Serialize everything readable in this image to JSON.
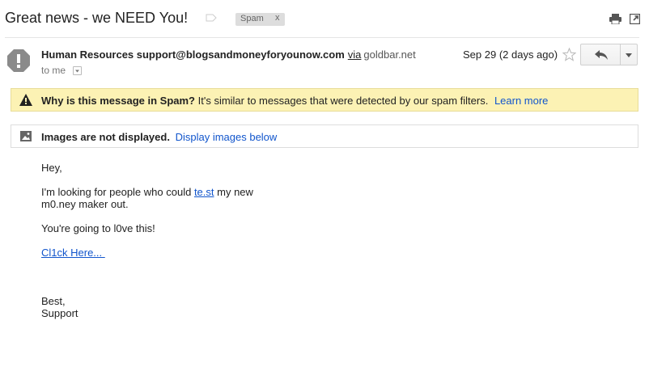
{
  "subject": "Great news - we NEED You!",
  "label_chip": {
    "text": "Spam",
    "remove": "x"
  },
  "icons": {
    "label": "label-outline-icon",
    "print": "printer-icon",
    "new_window": "open-in-new-window-icon",
    "avatar": "exclamation-avatar-icon",
    "star": "star-icon",
    "reply": "reply-arrow-icon",
    "more": "chevron-down-icon",
    "warning": "warning-triangle-icon",
    "image": "image-icon"
  },
  "sender": {
    "name_email": "Human Resources support@blogsandmoneyforyounow.com",
    "via": "via",
    "domain": "goldbar.net"
  },
  "to_line": "to me",
  "date": "Sep 29 (2 days ago)",
  "spam_banner": {
    "heading": "Why is this message in Spam?",
    "text": "It's similar to messages that were detected by our spam filters.",
    "link": "Learn more"
  },
  "images_banner": {
    "heading": "Images are not displayed.",
    "link": "Display images below"
  },
  "body": {
    "greeting": "Hey,",
    "line1_pre": "I'm looking for people who could ",
    "line1_link": "te.st",
    "line1_post": " my new",
    "line2": "m0.ney maker out.",
    "line3": "You're going to l0ve this!",
    "click_link": "Cl1ck Here... ",
    "signoff": "Best,",
    "signature": "Support"
  },
  "colors": {
    "link": "#1155cc",
    "spam_banner_bg": "#fcf2b4",
    "avatar_bg": "#8a8a8a"
  }
}
